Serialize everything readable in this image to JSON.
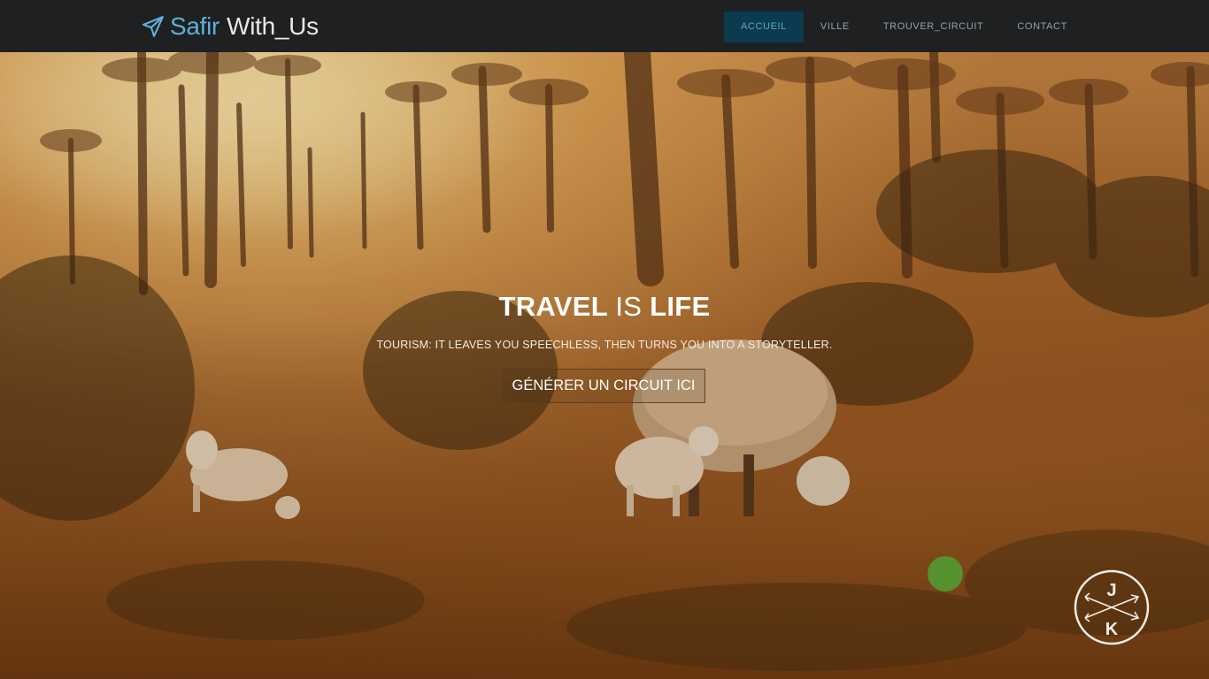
{
  "brand": {
    "part1": "Safir",
    "part2": "With_Us",
    "icon": "paper-plane-icon"
  },
  "nav": {
    "items": [
      {
        "label": "ACCUEIL",
        "active": true
      },
      {
        "label": "VILLE",
        "active": false
      },
      {
        "label": "TROUVER_CIRCUIT",
        "active": false
      },
      {
        "label": "CONTACT",
        "active": false
      }
    ]
  },
  "hero": {
    "title_w1": "TRAVEL",
    "title_w2": "IS",
    "title_w3": "LIFE",
    "subtitle": "TOURISM: IT LEAVES YOU SPEECHLESS, THEN TURNS YOU INTO A STORYTELLER.",
    "cta_label": "GÉNÉRER UN CIRCUIT ICI"
  },
  "badge": {
    "letter_top": "J",
    "letter_bottom": "K"
  },
  "colors": {
    "navbar_bg": "#1e2021",
    "brand_accent": "#5fb0d8",
    "nav_active_bg": "#0c3a4e",
    "nav_active_text": "#5aa9cd",
    "nav_text": "#9aa0a3"
  }
}
